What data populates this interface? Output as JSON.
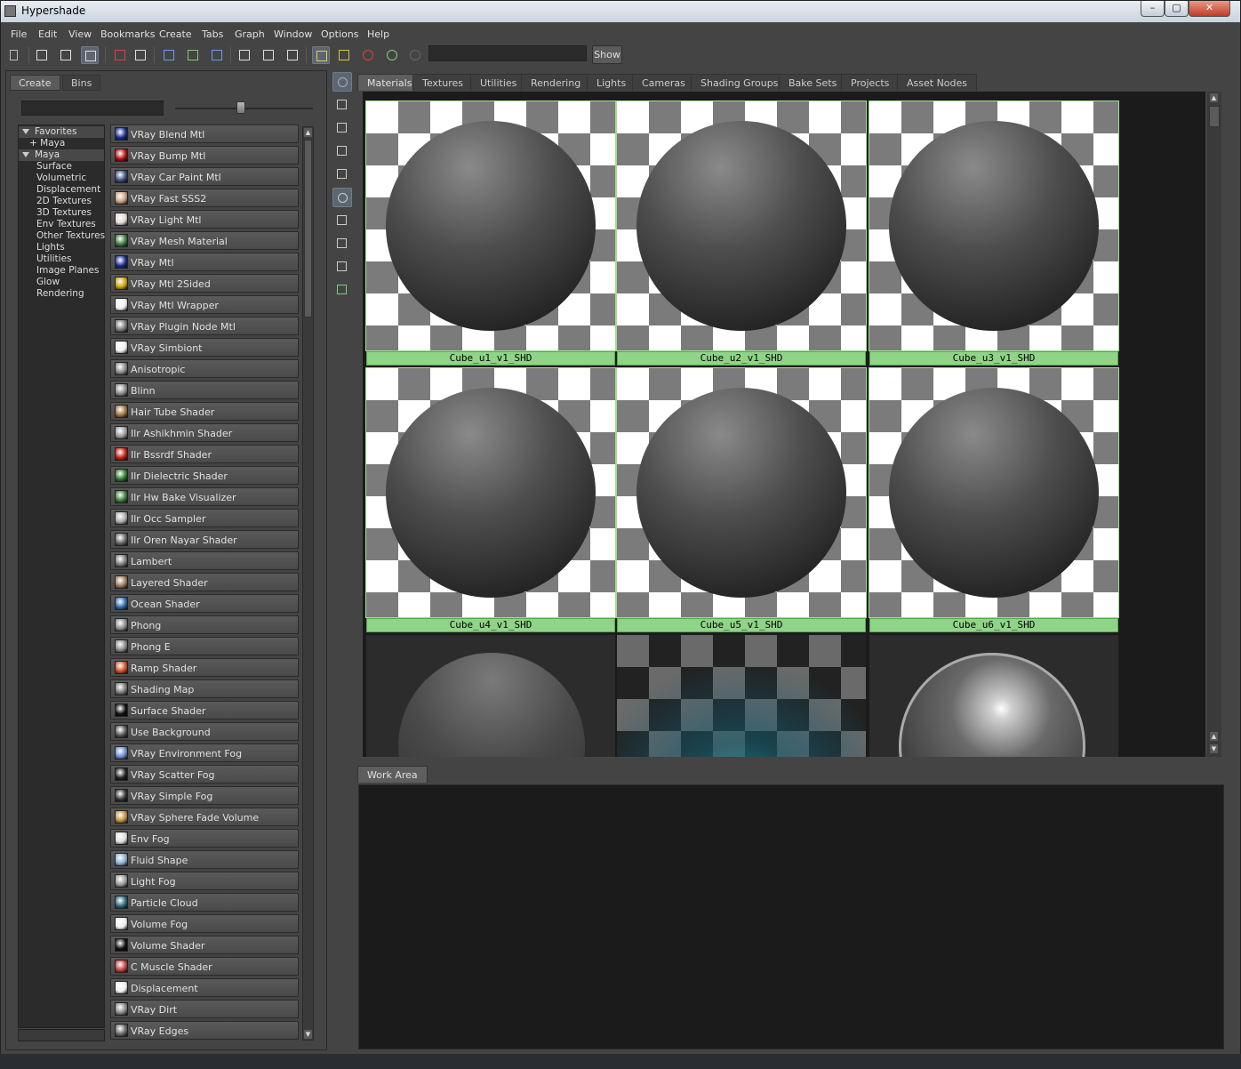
{
  "window": {
    "title": "Hypershade",
    "minimize": "–",
    "maximize": "▢",
    "close": "✕"
  },
  "menu": [
    "File",
    "Edit",
    "View",
    "Bookmarks",
    "Create",
    "Tabs",
    "Graph",
    "Window",
    "Options",
    "Help"
  ],
  "toolbar": {
    "search_value": "",
    "show_label": "Show"
  },
  "left": {
    "tabs": [
      "Create",
      "Bins"
    ],
    "tree": [
      {
        "label": "Favorites",
        "group": true
      },
      {
        "label": "+ Maya",
        "group": false,
        "indent": 1
      },
      {
        "label": "Maya",
        "group": true
      },
      {
        "label": "Surface",
        "indent": 2
      },
      {
        "label": "Volumetric",
        "indent": 2
      },
      {
        "label": "Displacement",
        "indent": 2
      },
      {
        "label": "2D Textures",
        "indent": 2
      },
      {
        "label": "3D Textures",
        "indent": 2
      },
      {
        "label": "Env Textures",
        "indent": 2
      },
      {
        "label": "Other Textures",
        "indent": 2
      },
      {
        "label": "Lights",
        "indent": 2
      },
      {
        "label": "Utilities",
        "indent": 2
      },
      {
        "label": "Image Planes",
        "indent": 2
      },
      {
        "label": "Glow",
        "indent": 2
      },
      {
        "label": "Rendering",
        "indent": 2
      }
    ],
    "nodes": [
      {
        "label": "VRay Blend Mtl",
        "icon": "vray-blend-icon",
        "color": "#1a2e8a"
      },
      {
        "label": "VRay Bump Mtl",
        "icon": "vray-bump-icon",
        "color": "#b01010"
      },
      {
        "label": "VRay Car Paint Mtl",
        "icon": "vray-carpaint-icon",
        "color": "#3a4d7a"
      },
      {
        "label": "VRay Fast SSS2",
        "icon": "vray-sss-icon",
        "color": "#c9a07a"
      },
      {
        "label": "VRay Light Mtl",
        "icon": "vray-light-icon",
        "color": "#e0d8d0"
      },
      {
        "label": "VRay Mesh Material",
        "icon": "vray-mesh-icon",
        "color": "#3a7a3a"
      },
      {
        "label": "VRay Mtl",
        "icon": "vray-mtl-icon",
        "color": "#1a2e8a"
      },
      {
        "label": "VRay Mtl 2Sided",
        "icon": "vray-2sided-icon",
        "color": "#d0a000"
      },
      {
        "label": "VRay Mtl Wrapper",
        "icon": "vray-wrapper-icon",
        "color": "#f0f0f0"
      },
      {
        "label": "VRay Plugin Node Mtl",
        "icon": "vray-plugin-icon",
        "color": "#777777"
      },
      {
        "label": "VRay Simbiont",
        "icon": "vray-simbiont-icon",
        "color": "#eeeeee"
      },
      {
        "label": "Anisotropic",
        "icon": "anisotropic-icon",
        "color": "#888888"
      },
      {
        "label": "Blinn",
        "icon": "blinn-icon",
        "color": "#888888"
      },
      {
        "label": "Hair Tube Shader",
        "icon": "hair-tube-icon",
        "color": "#a0703a"
      },
      {
        "label": "Ilr Ashikhmin Shader",
        "icon": "ashikhmin-icon",
        "color": "#999999"
      },
      {
        "label": "Ilr Bssrdf Shader",
        "icon": "bssrdf-icon",
        "color": "#c02010"
      },
      {
        "label": "Ilr Dielectric Shader",
        "icon": "dielectric-icon",
        "color": "#2a7a2a"
      },
      {
        "label": "Ilr Hw Bake Visualizer",
        "icon": "hw-bake-icon",
        "color": "#3a7a3a"
      },
      {
        "label": "Ilr Occ Sampler",
        "icon": "occ-sampler-icon",
        "color": "#aaaaaa"
      },
      {
        "label": "Ilr Oren Nayar Shader",
        "icon": "oren-nayar-icon",
        "color": "#666666"
      },
      {
        "label": "Lambert",
        "icon": "lambert-icon",
        "color": "#777777"
      },
      {
        "label": "Layered Shader",
        "icon": "layered-icon",
        "color": "#9a7a5a"
      },
      {
        "label": "Ocean Shader",
        "icon": "ocean-icon",
        "color": "#2a6ab0"
      },
      {
        "label": "Phong",
        "icon": "phong-icon",
        "color": "#888888"
      },
      {
        "label": "Phong E",
        "icon": "phonge-icon",
        "color": "#888888"
      },
      {
        "label": "Ramp Shader",
        "icon": "ramp-icon",
        "color": "#d05020"
      },
      {
        "label": "Shading Map",
        "icon": "shading-map-icon",
        "color": "#777777"
      },
      {
        "label": "Surface Shader",
        "icon": "surface-shader-icon",
        "color": "#111111"
      },
      {
        "label": "Use Background",
        "icon": "use-background-icon",
        "color": "#555555"
      },
      {
        "label": "VRay Environment Fog",
        "icon": "env-fog-icon",
        "color": "#6a8ad0"
      },
      {
        "label": "VRay Scatter Fog",
        "icon": "scatter-fog-icon",
        "color": "#222222"
      },
      {
        "label": "VRay Simple Fog",
        "icon": "simple-fog-icon",
        "color": "#333333"
      },
      {
        "label": "VRay Sphere Fade Volume",
        "icon": "sphere-fade-icon",
        "color": "#c09040"
      },
      {
        "label": "Env Fog",
        "icon": "env-fog2-icon",
        "color": "#dddddd"
      },
      {
        "label": "Fluid Shape",
        "icon": "fluid-icon",
        "color": "#8ab0d0"
      },
      {
        "label": "Light Fog",
        "icon": "light-fog-icon",
        "color": "#999999"
      },
      {
        "label": "Particle Cloud",
        "icon": "particle-cloud-icon",
        "color": "#2a6a7a"
      },
      {
        "label": "Volume Fog",
        "icon": "volume-fog-icon",
        "color": "#eeeeee"
      },
      {
        "label": "Volume Shader",
        "icon": "volume-shader-icon",
        "color": "#111111"
      },
      {
        "label": "C Muscle Shader",
        "icon": "muscle-icon",
        "color": "#c04040"
      },
      {
        "label": "Displacement",
        "icon": "displacement-icon",
        "color": "#eeeeee"
      },
      {
        "label": "VRay Dirt",
        "icon": "vray-dirt-icon",
        "color": "#888888"
      },
      {
        "label": "VRay Edges",
        "icon": "vray-edges-icon",
        "color": "#666666"
      }
    ]
  },
  "top": {
    "tabs": [
      "Materials",
      "Textures",
      "Utilities",
      "Rendering",
      "Lights",
      "Cameras",
      "Shading Groups",
      "Bake Sets",
      "Projects",
      "Asset Nodes"
    ],
    "swatches": [
      "Cube_u1_v1_SHD",
      "Cube_u2_v1_SHD",
      "Cube_u3_v1_SHD",
      "Cube_u4_v1_SHD",
      "Cube_u5_v1_SHD",
      "Cube_u6_v1_SHD"
    ]
  },
  "work": {
    "tab": "Work Area"
  },
  "colors": {
    "selection_green": "#8fd487",
    "panel": "#444444",
    "dark": "#1b1b1b"
  }
}
